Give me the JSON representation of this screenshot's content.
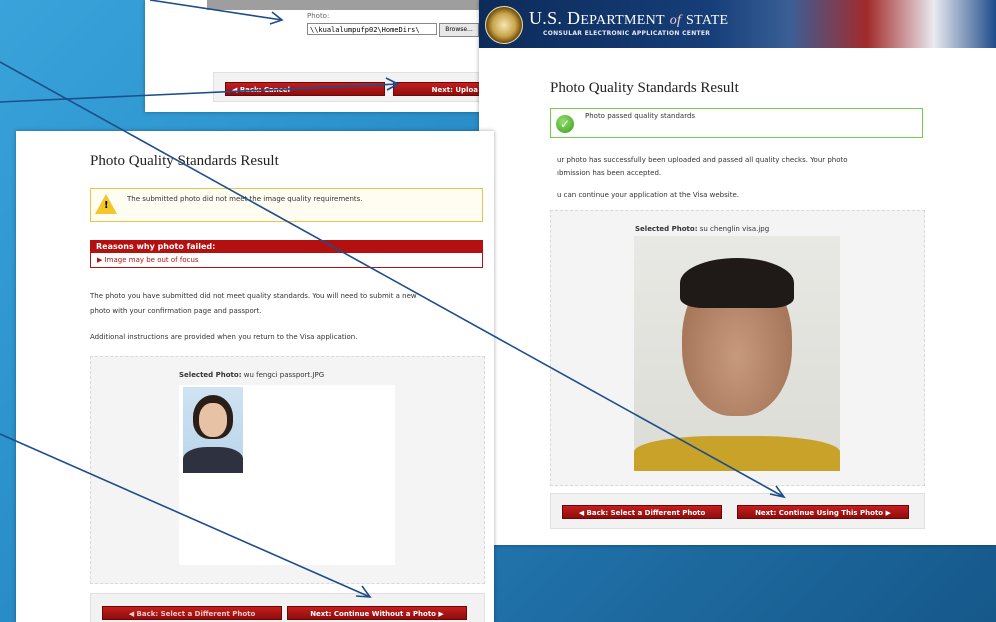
{
  "upload_panel": {
    "photo_label": "Photo:",
    "file_path": "\\\\kualalumpufp02\\HomeDirs\\",
    "browse_label": "Browse...",
    "back_label": "◀ Back: Cancel",
    "next_label": "Next: Uploa"
  },
  "header": {
    "title_prefix": "U.S. D",
    "title_main": "EPARTMENT",
    "title_of": "of",
    "title_state": "STATE",
    "subtitle": "CONSULAR ELECTRONIC APPLICATION CENTER"
  },
  "passed": {
    "heading": "Photo Quality Standards Result",
    "status": "Photo passed quality standards",
    "para1_line1": "ur photo has successfully been uploaded and passed all quality checks. Your photo",
    "para1_line2": "ıbmission has been accepted.",
    "para2": "u can continue your application at the Visa website.",
    "selected_label": "Selected Photo:",
    "selected_file": "su chenglin visa.jpg",
    "back_label": "◀ Back: Select a Different Photo",
    "next_label": "Next: Continue Using This Photo ▶"
  },
  "failed": {
    "heading": "Photo Quality Standards Result",
    "warning": "The submitted photo did not meet the image quality requirements.",
    "reasons_title": "Reasons why photo failed:",
    "reason_item": "▶ Image may be out of focus",
    "para1_line1": "The photo you have submitted did not meet quality standards. You will need to submit a new",
    "para1_line2": "photo with your confirmation page and passport.",
    "para2": "Additional instructions are provided when you return to the Visa application.",
    "selected_label": "Selected Photo:",
    "selected_file": "wu fengci passport.JPG",
    "back_label": "◀ Back: Select a Different Photo",
    "next_label": "Next: Continue Without a Photo ▶"
  },
  "colors": {
    "accent_red": "#b51010",
    "success_green": "#5ec236",
    "arrow_blue": "#1c4e8c"
  },
  "icons": [
    "seal-icon",
    "check-icon",
    "warning-icon"
  ]
}
